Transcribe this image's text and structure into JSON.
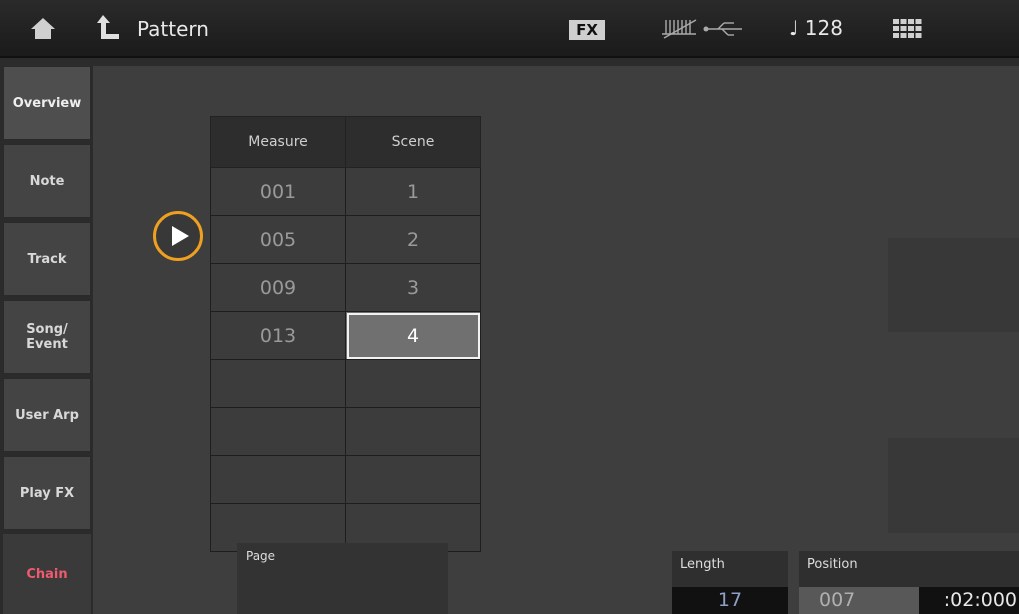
{
  "header": {
    "title": "Pattern",
    "fx_label": "FX",
    "tempo": "♩ 128"
  },
  "sidebar": {
    "items": [
      {
        "label": "Overview"
      },
      {
        "label": "Note"
      },
      {
        "label": "Track"
      },
      {
        "label": "Song/\nEvent"
      },
      {
        "label": "User Arp"
      },
      {
        "label": "Play FX"
      },
      {
        "label": "Chain",
        "selected": true
      }
    ]
  },
  "chain_table": {
    "headers": [
      "Measure",
      "Scene"
    ],
    "rows": [
      [
        "001",
        "1"
      ],
      [
        "005",
        "2"
      ],
      [
        "009",
        "3"
      ],
      [
        "013",
        "4"
      ],
      [
        "",
        ""
      ],
      [
        "",
        ""
      ],
      [
        "",
        ""
      ],
      [
        "",
        ""
      ]
    ],
    "selected_cell": "row 4, Scene"
  },
  "footer": {
    "page_label": "Page",
    "length_label": "Length",
    "length_value": "17",
    "position_label": "Position",
    "position_measure": "007",
    "position_time": ":02:000"
  },
  "colors": {
    "accent_orange": "#f0a020",
    "selected_tab_text": "#ef5a6e"
  },
  "icons": [
    "home-icon",
    "back-arrow-icon",
    "midi-usb-icon",
    "quick-access-grid-icon",
    "play-icon"
  ]
}
